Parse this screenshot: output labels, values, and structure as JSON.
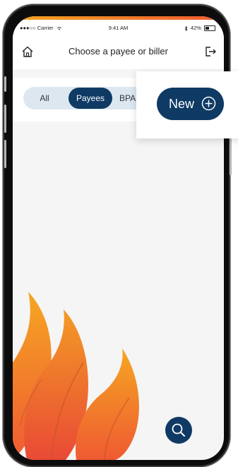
{
  "status_bar": {
    "carrier": "●●●○○ Carrier",
    "time": "9:41 AM",
    "battery": "42%"
  },
  "header": {
    "title": "Choose a payee or biller"
  },
  "filter": {
    "options": [
      "All",
      "Payees",
      "BPA"
    ],
    "selected": "Payees"
  },
  "new_button": {
    "label": "New"
  },
  "icons": {
    "home": "home-icon",
    "exit": "exit-icon",
    "search": "search-icon",
    "plus": "plus-circle-icon",
    "wifi": "wifi-icon",
    "bluetooth": "bluetooth-icon",
    "battery": "battery-icon"
  },
  "colors": {
    "primary": "#0e3a64",
    "segmented_bg": "#dce7f0",
    "flame_orange": "#f5a623",
    "flame_red": "#ef5a32"
  }
}
